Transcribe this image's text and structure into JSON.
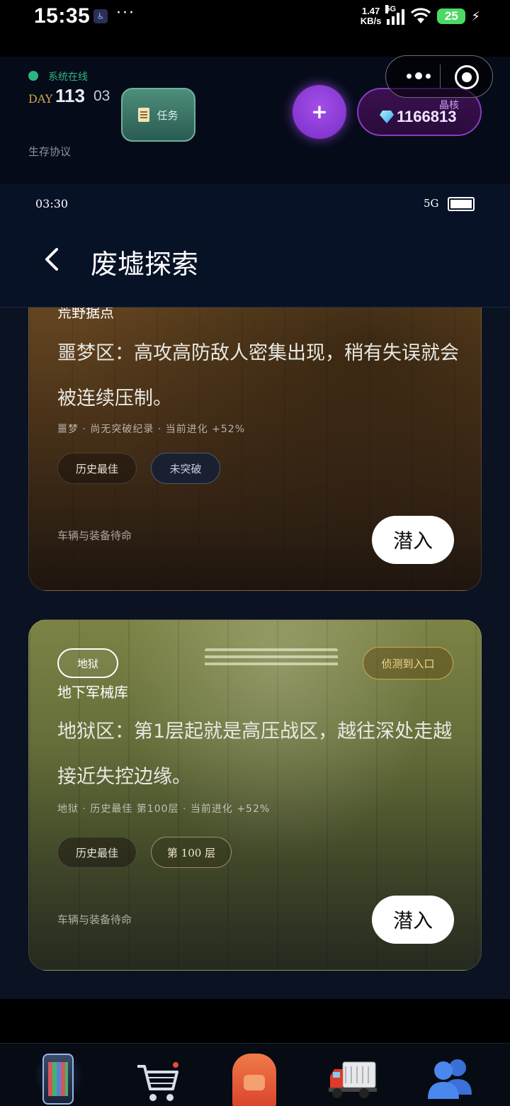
{
  "os_status": {
    "time": "15:35",
    "accessibility_glyph": "♿",
    "more": "···",
    "net_speed_value": "1.47",
    "net_speed_unit": "KB/s",
    "signal_type": "5G",
    "battery_level": "25",
    "charging_glyph": "⚡"
  },
  "header": {
    "online_status": "系统在线",
    "day_label": "DAY",
    "day_number": "113",
    "day_sub": "03",
    "protocol": "生存协议",
    "task_button": "任务",
    "plus_button": "+",
    "core_label": "晶核",
    "core_value": "1166813",
    "colors": {
      "online": "#2bb582",
      "task_bg": "#3f7a6a",
      "plus_bg": "#8b3bd9",
      "core_border": "#8b3bc7"
    }
  },
  "inner_status": {
    "time": "03:30",
    "network": "5G"
  },
  "nav": {
    "back_glyph": "‹",
    "title": "废墟探索"
  },
  "cards": [
    {
      "name": "荒野据点",
      "description": "噩梦区：高攻高防敌人密集出现，稍有失误就会被连续压制。",
      "meta": "噩梦 · 尚无突破纪录 · 当前进化 +52%",
      "tags": [
        "历史最佳",
        "未突破"
      ],
      "footer": "车辆与装备待命",
      "action": "潜入"
    },
    {
      "difficulty_badge": "地狱",
      "status_badge": "侦测到入口",
      "name": "地下军械库",
      "description": "地狱区：第1层起就是高压战区，越往深处走越接近失控边缘。",
      "meta": "地狱 · 历史最佳 第100层 · 当前进化 +52%",
      "tags": [
        "历史最佳",
        "第 100 层"
      ],
      "footer": "车辆与装备待命",
      "action": "潜入"
    }
  ],
  "tabbar": {
    "items": [
      {
        "icon": "phone-icon",
        "active": true
      },
      {
        "icon": "shopping-cart-icon",
        "active": false
      },
      {
        "icon": "backpack-icon",
        "active": false
      },
      {
        "icon": "truck-icon",
        "active": false
      },
      {
        "icon": "users-icon",
        "active": false
      }
    ]
  }
}
